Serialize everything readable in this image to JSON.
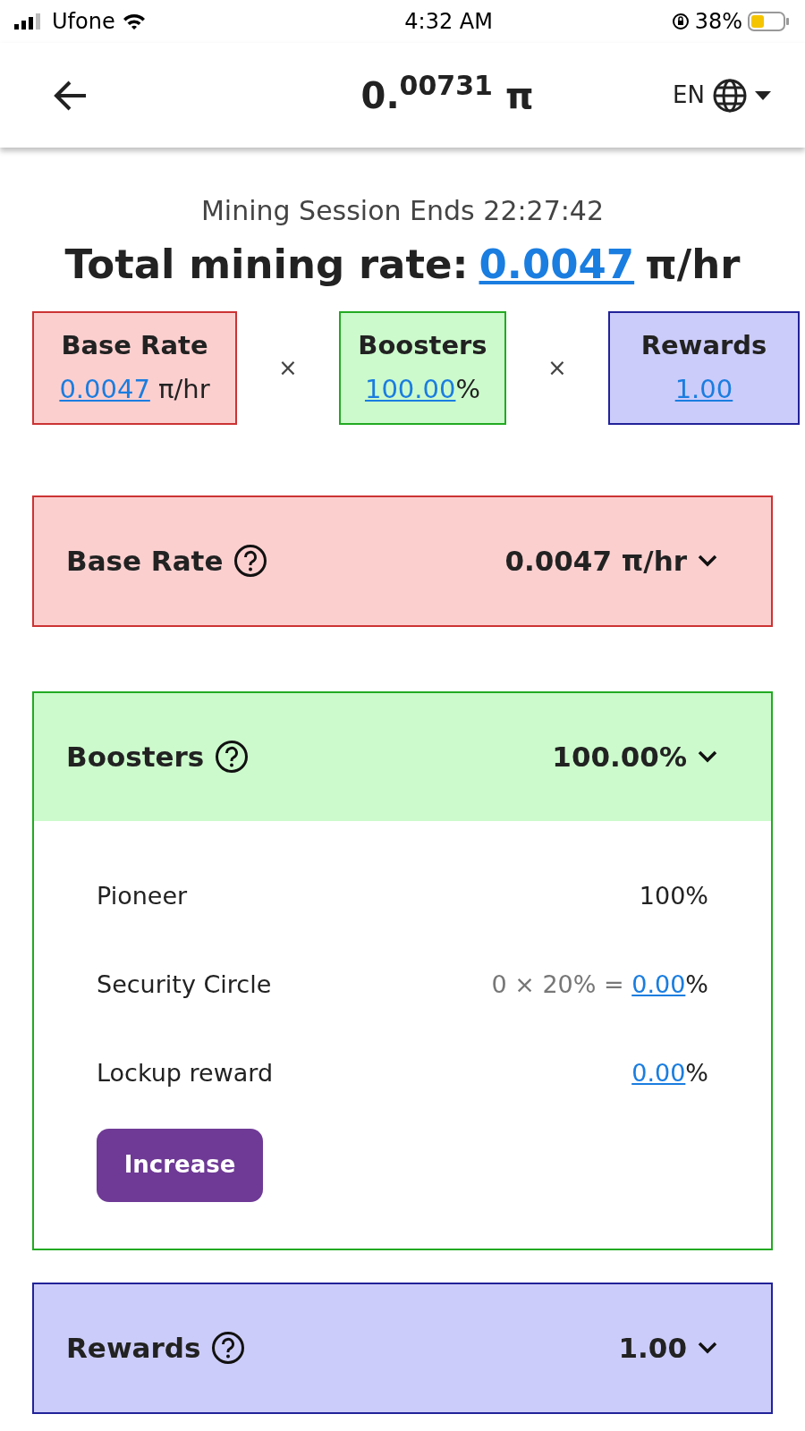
{
  "status_bar": {
    "carrier": "Ufone",
    "time": "4:32 AM",
    "battery": "38%"
  },
  "header": {
    "balance": "0.$^{00731}$ π",
    "language": "EN"
  },
  "session": "Mining Session Ends 22:27:42",
  "total": {
    "label": "Total mining rate:",
    "value": "0.0047",
    "unit": "π/hr"
  },
  "factors": [
    {
      "kind": "base",
      "title": "Base Rate",
      "value": "0.0047",
      "unit": " π/hr"
    },
    {
      "kind": "boosters",
      "title": "Boosters",
      "value": "100.00",
      "unit": "%"
    },
    {
      "kind": "rewards",
      "title": "Rewards",
      "value": "1.00"
    }
  ],
  "operators": [
    "×",
    "×"
  ],
  "sections": [
    {
      "kind": "base",
      "title": "Base Rate",
      "value": "0.0047 π/hr",
      "expanded": false
    },
    {
      "kind": "boosters",
      "title": "Boosters",
      "value": "100.00%",
      "expanded": true,
      "rows": [
        {
          "label": "Pioneer",
          "value": "100%"
        },
        {
          "label": "Security Circle",
          "prefix": "0 × 20% = ",
          "link": "0.00",
          "suffix": "%"
        },
        {
          "label": "Lockup reward",
          "link": "0.00",
          "suffix": "%"
        }
      ],
      "button": "Increase"
    },
    {
      "kind": "rewards",
      "title": "Rewards",
      "value": "1.00",
      "expanded": false
    }
  ]
}
